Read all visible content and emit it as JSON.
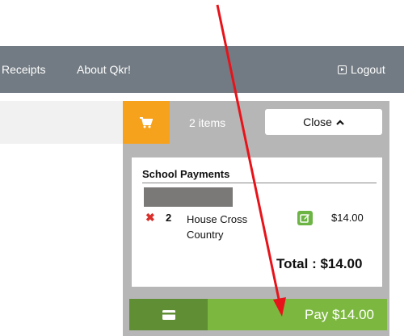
{
  "nav": {
    "receipts_label": "Receipts",
    "about_label": "About Qkr!",
    "logout_label": "Logout"
  },
  "cart": {
    "items_count": "2 items",
    "close_label": "Close",
    "section_title": "School Payments",
    "line_item": {
      "quantity": "2",
      "name": "House Cross Country",
      "price": "$14.00"
    },
    "total_label": "Total : $14.00",
    "pay_label": "Pay $14.00"
  },
  "icons": {
    "cart": "shopping-cart-icon",
    "close_chevron": "chevron-up-icon",
    "remove": "remove-x-icon",
    "edit": "edit-icon",
    "card": "credit-card-icon",
    "logout": "logout-icon"
  },
  "colors": {
    "navbar": "#727b83",
    "cart_toggle": "#f7a21c",
    "pay_button": "#7cb83f",
    "card_button": "#5f8e35",
    "remove_icon": "#d9302c",
    "annotation_arrow": "#e8131a"
  }
}
